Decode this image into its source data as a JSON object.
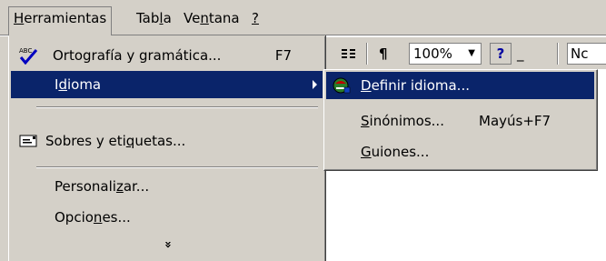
{
  "menubar": {
    "items": [
      {
        "pre": "",
        "ul": "H",
        "post": "erramientas"
      },
      {
        "pre": "Tab",
        "ul": "l",
        "post": "a"
      },
      {
        "pre": "Ve",
        "ul": "n",
        "post": "tana"
      },
      {
        "pre": "",
        "ul": "?",
        "post": ""
      }
    ]
  },
  "toolbar": {
    "zoom_value": "100%",
    "help_label": "?",
    "font_value": "Nc"
  },
  "menu": {
    "spelling": {
      "label": "Ortografía y gramática...",
      "shortcut": "F7",
      "icon": "spellcheck-icon"
    },
    "language": {
      "pre": "I",
      "ul": "d",
      "post": "ioma"
    },
    "envelopes": {
      "pre": "Sobres y eti",
      "ul": "q",
      "post": "uetas...",
      "icon": "envelope-icon"
    },
    "customize": {
      "pre": "Personali",
      "ul": "z",
      "post": "ar..."
    },
    "options": {
      "pre": "Opcio",
      "ul": "n",
      "post": "es..."
    },
    "expand_label": "»"
  },
  "submenu": {
    "define": {
      "pre": "",
      "ul": "D",
      "post": "efinir idioma...",
      "icon": "globe-language-icon"
    },
    "synonyms": {
      "pre": "",
      "ul": "S",
      "post": "inónimos...",
      "shortcut": "Mayús+F7"
    },
    "hyphen": {
      "pre": "",
      "ul": "G",
      "post": "uiones..."
    }
  },
  "colors": {
    "highlight": "#0a246a",
    "face": "#d4d0c8"
  }
}
